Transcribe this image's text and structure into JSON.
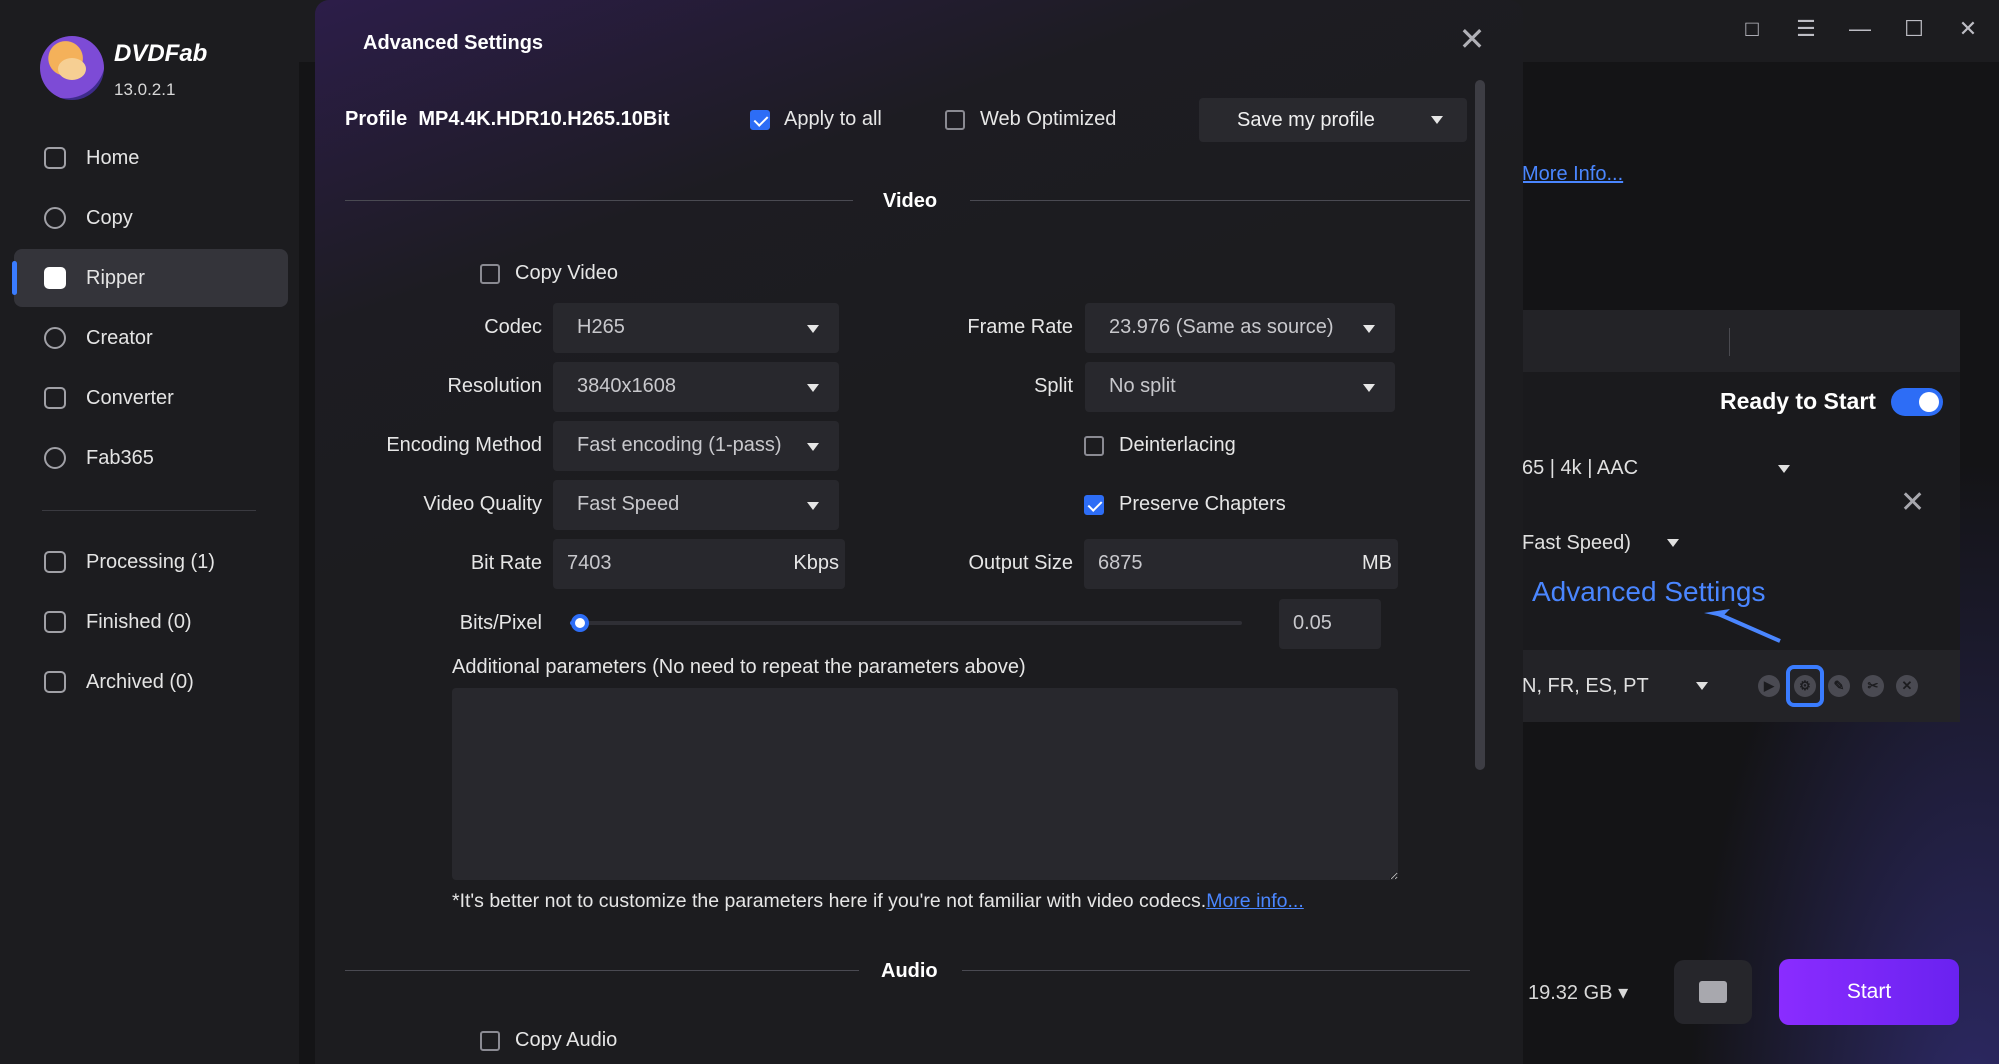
{
  "app": {
    "brand": "DVDFab",
    "version": "13.0.2.1"
  },
  "sidebar": {
    "items": [
      {
        "label": "Home",
        "icon": "home-icon"
      },
      {
        "label": "Copy",
        "icon": "copy-icon"
      },
      {
        "label": "Ripper",
        "icon": "ripper-icon",
        "active": true
      },
      {
        "label": "Creator",
        "icon": "creator-icon"
      },
      {
        "label": "Converter",
        "icon": "converter-icon"
      },
      {
        "label": "Fab365",
        "icon": "fab365-icon"
      }
    ],
    "queue": [
      {
        "label": "Processing (1)",
        "icon": "processing-icon"
      },
      {
        "label": "Finished (0)",
        "icon": "finished-icon"
      },
      {
        "label": "Archived (0)",
        "icon": "archived-icon"
      }
    ]
  },
  "background": {
    "more_info": "More Info...",
    "ready_label": "Ready to Start",
    "ready_toggle": true,
    "audio_summary": "65 | 4k | AAC",
    "quality_summary": "Fast Speed)",
    "callout": "Advanced Settings",
    "subtitles": "N, FR, ES, PT",
    "output_size": "19.32 GB",
    "start_label": "Start",
    "accent": "#2d6df6",
    "start_color": "#8a2cff"
  },
  "modal": {
    "title": "Advanced Settings",
    "profile_label": "Profile",
    "profile_name": "MP4.4K.HDR10.H265.10Bit",
    "apply_to_all": {
      "label": "Apply to all",
      "checked": true
    },
    "web_optimized": {
      "label": "Web Optimized",
      "checked": false
    },
    "save_profile": "Save my profile",
    "video": {
      "section_title": "Video",
      "copy_video": {
        "label": "Copy Video",
        "checked": false
      },
      "codec": {
        "label": "Codec",
        "value": "H265"
      },
      "resolution": {
        "label": "Resolution",
        "value": "3840x1608"
      },
      "encoding_method": {
        "label": "Encoding Method",
        "value": "Fast encoding (1-pass)"
      },
      "video_quality": {
        "label": "Video Quality",
        "value": "Fast Speed"
      },
      "bit_rate": {
        "label": "Bit Rate",
        "value": "7403",
        "unit": "Kbps"
      },
      "frame_rate": {
        "label": "Frame Rate",
        "value": "23.976 (Same as source)"
      },
      "split": {
        "label": "Split",
        "value": "No split"
      },
      "deinterlacing": {
        "label": "Deinterlacing",
        "checked": false
      },
      "preserve_chapters": {
        "label": "Preserve Chapters",
        "checked": true
      },
      "output_size": {
        "label": "Output Size",
        "value": "6875",
        "unit": "MB"
      },
      "bits_pixel": {
        "label": "Bits/Pixel",
        "value": "0.05",
        "slider_fraction": 0.01
      },
      "additional_params_label": "Additional parameters (No need to repeat the parameters above)",
      "additional_params_value": "",
      "note": "*It's better not to customize the parameters here if you're not familiar with video codecs.",
      "note_link": "More info..."
    },
    "audio": {
      "section_title": "Audio",
      "copy_audio": {
        "label": "Copy Audio",
        "checked": false
      }
    }
  }
}
